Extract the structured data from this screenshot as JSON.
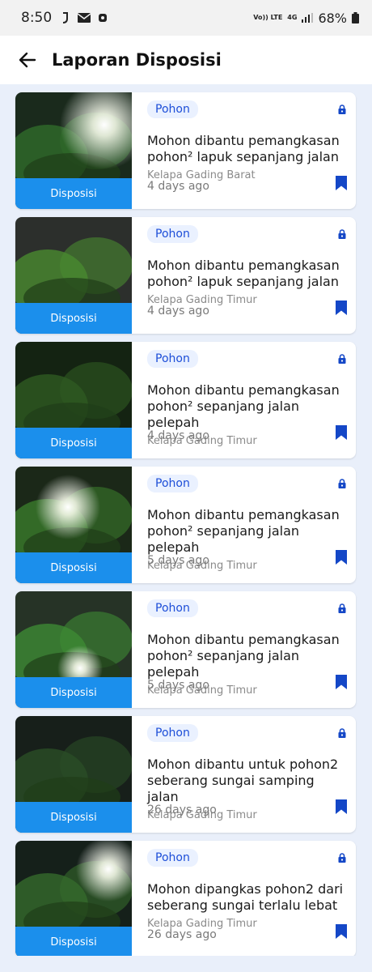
{
  "status_bar": {
    "time": "8:50",
    "volte": "Vo)) LTE",
    "network": "4G",
    "battery": "68%",
    "icons": [
      "notification-icon",
      "mail-icon",
      "app-icon",
      "signal-icon",
      "battery-icon"
    ]
  },
  "header": {
    "title": "Laporan Disposisi",
    "back_icon": "arrow-left-icon"
  },
  "colors": {
    "accent": "#1b8fec",
    "chip_text": "#1d4ed8",
    "chip_bg": "#eaf1ff",
    "bookmark": "#1447c7",
    "background": "#e9effa"
  },
  "reports": [
    {
      "category": "Pohon",
      "title": "Mohon dibantu pemangkasan pohon² lapuk sepanjang jalan",
      "location": "Kelapa Gading Barat",
      "time": "4 days ago",
      "status": "Disposisi"
    },
    {
      "category": "Pohon",
      "title": "Mohon dibantu pemangkasan pohon² lapuk sepanjang jalan",
      "location": "Kelapa Gading Timur",
      "time": "4 days ago",
      "status": "Disposisi"
    },
    {
      "category": "Pohon",
      "title": "Mohon dibantu pemangkasan pohon² sepanjang jalan pelepah",
      "location": "Kelapa Gading Timur",
      "time": "4 days ago",
      "status": "Disposisi"
    },
    {
      "category": "Pohon",
      "title": "Mohon dibantu pemangkasan pohon² sepanjang jalan pelepah",
      "location": "Kelapa Gading Timur",
      "time": "5 days ago",
      "status": "Disposisi"
    },
    {
      "category": "Pohon",
      "title": "Mohon dibantu pemangkasan pohon² sepanjang jalan pelepah",
      "location": "Kelapa Gading Timur",
      "time": "5 days ago",
      "status": "Disposisi"
    },
    {
      "category": "Pohon",
      "title": "Mohon dibantu untuk pohon2 seberang sungai samping jalan",
      "location": "Kelapa Gading Timur",
      "time": "26 days ago",
      "status": "Disposisi"
    },
    {
      "category": "Pohon",
      "title": "Mohon dipangkas pohon2 dari seberang sungai terlalu lebat",
      "location": "Kelapa Gading Timur",
      "time": "26 days ago",
      "status": "Disposisi"
    }
  ]
}
